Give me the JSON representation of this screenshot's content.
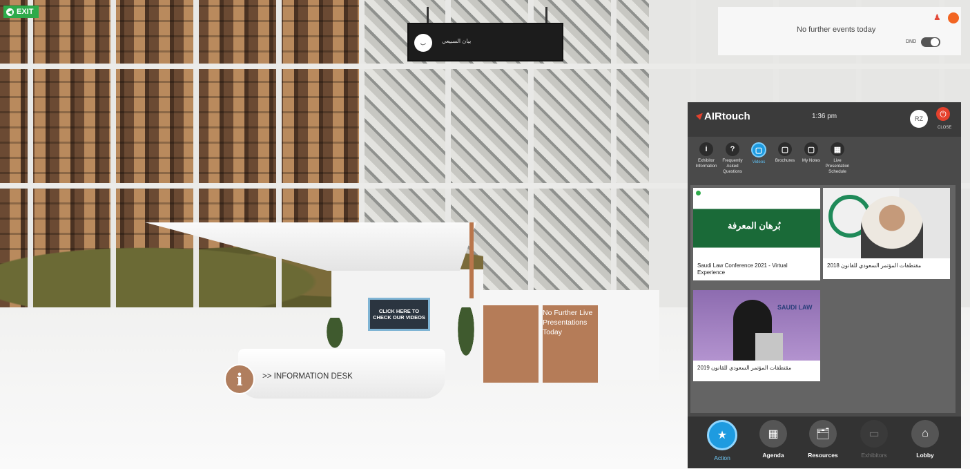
{
  "top_bar": {
    "exit_label": "EXIT",
    "exit_icon": "arrow-left-icon"
  },
  "hanging_screen": {
    "avatar_initial": "ب",
    "name": "بيان السبيعي"
  },
  "events": {
    "message": "No further events today",
    "dnd_label": "DND",
    "dnd_on": false,
    "notification_icon": "user-alert-icon"
  },
  "booth": {
    "video_sign": "CLICK HERE TO CHECK OUR VIDEOS",
    "door_text": "No Further Live Presentations Today",
    "info_icon_glyph": "i",
    "info_desk_label": ">> INFORMATION DESK"
  },
  "airtouch": {
    "logo": "AIRtouch",
    "time": "1:36 pm",
    "user_initials": "RZ",
    "close_label": "CLOSE",
    "accent_color": "#1e9be0",
    "brand_color": "#e5412d",
    "tabs": [
      {
        "glyph": "i",
        "icon": "info-icon",
        "label": "Exhibitor Information",
        "active": false
      },
      {
        "glyph": "?",
        "icon": "question-icon",
        "label": "Frequently Asked Questions",
        "active": false
      },
      {
        "glyph": "▢",
        "icon": "video-icon",
        "label": "Videos",
        "active": true
      },
      {
        "glyph": "▢",
        "icon": "brochure-icon",
        "label": "Brochures",
        "active": false
      },
      {
        "glyph": "▢",
        "icon": "notes-icon",
        "label": "My Notes",
        "active": false
      },
      {
        "glyph": "▦",
        "icon": "schedule-icon",
        "label": "Live Presentation Schedule",
        "active": false
      }
    ],
    "cards": [
      {
        "title": "Saudi Law Conference 2021 - Virtual Experience",
        "thumb_text": "بُرهان المعرفة"
      },
      {
        "title": "مقتطفات المؤتمر السعودي للقانون 2018",
        "thumb_text": ""
      },
      {
        "title": "مقتطفات المؤتمر السعودي للقانون 2019",
        "thumb_text": "SAUDI LAW"
      }
    ],
    "footer_nav": [
      {
        "glyph": "★",
        "icon": "star-icon",
        "label": "Action",
        "state": "active"
      },
      {
        "glyph": "▦",
        "icon": "calendar-icon",
        "label": "Agenda",
        "state": "normal"
      },
      {
        "glyph": "🗂",
        "icon": "resources-icon",
        "label": "Resources",
        "state": "normal"
      },
      {
        "glyph": "▭",
        "icon": "monitor-icon",
        "label": "Exhibitors",
        "state": "disabled"
      },
      {
        "glyph": "⌂",
        "icon": "home-icon",
        "label": "Lobby",
        "state": "normal"
      }
    ]
  }
}
